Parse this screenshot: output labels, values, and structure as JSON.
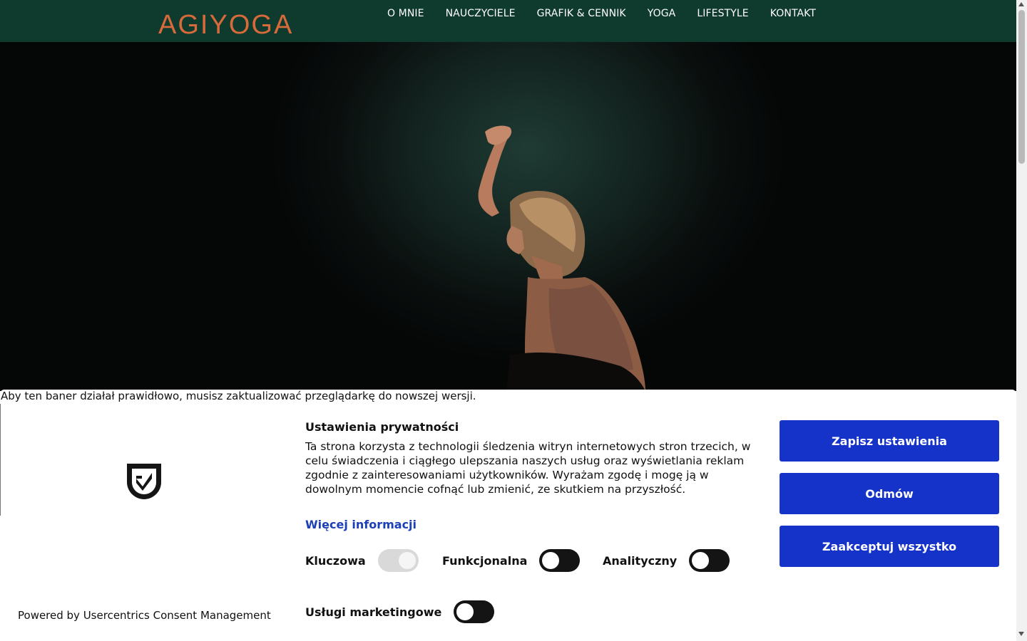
{
  "header": {
    "logo_text": "AGI YOGA",
    "logo_color": "#d76a3a",
    "background": "#0f3a2e",
    "nav": [
      "O MNIE",
      "NAUCZYCIELE",
      "GRAFIK & CENNIK",
      "YOGA",
      "LIFESTYLE",
      "KONTAKT"
    ]
  },
  "hero": {
    "image": "woman-yoga-pose-photo"
  },
  "banner": {
    "update_note": "Aby ten baner działał prawidłowo, musisz zaktualizować przeglądarkę do nowszej wersji.",
    "logo_icon": "shield-check-icon",
    "powered_by": "Powered by Usercentrics Consent Management",
    "title": "Ustawienia prywatności",
    "description": "Ta strona korzysta z technologii śledzenia witryn internetowych stron trzecich, w celu świadczenia i ciągłego ulepszania naszych usług oraz wyświetlania reklam zgodnie z zainteresowaniami użytkowników. Wyrażam zgodę i mogę ją w dowolnym momencie cofnąć lub zmienić, ze skutkiem na przyszłość.",
    "more_info": "Więcej informacji",
    "toggles": [
      {
        "label": "Kluczowa",
        "on": true,
        "disabled": true
      },
      {
        "label": "Funkcjonalna",
        "on": false,
        "disabled": false
      },
      {
        "label": "Analityczny",
        "on": false,
        "disabled": false
      },
      {
        "label": "Usługi marketingowe",
        "on": false,
        "disabled": false
      }
    ],
    "buttons": {
      "save": "Zapisz ustawienia",
      "deny": "Odmów",
      "accept_all": "Zaakceptuj wszystko"
    },
    "accent_color": "#1532c9"
  }
}
